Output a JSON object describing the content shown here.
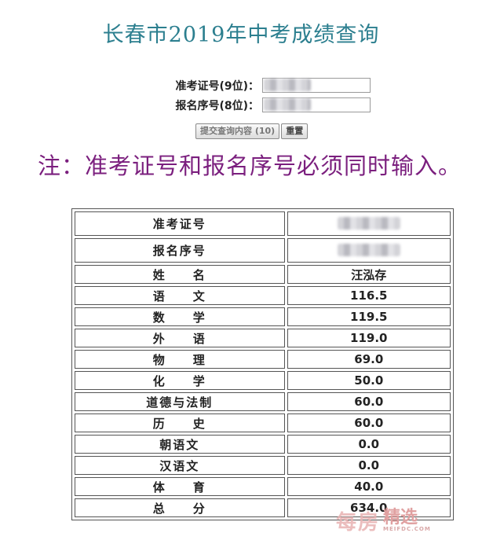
{
  "title": "长春市2019年中考成绩查询",
  "form": {
    "exam_id_label": "准考证号(9位)：",
    "reg_id_label": "报名序号(8位)：",
    "submit_label": "提交查询内容 (10)",
    "reset_label": "重置"
  },
  "note": "注：准考证号和报名序号必须同时输入。",
  "table": {
    "rows": [
      {
        "label": "准考证号",
        "value": ""
      },
      {
        "label": "报名序号",
        "value": ""
      },
      {
        "label": "姓　　名",
        "value": "汪泓存"
      },
      {
        "label": "语　　文",
        "value": "116.5"
      },
      {
        "label": "数　　学",
        "value": "119.5"
      },
      {
        "label": "外　　语",
        "value": "119.0"
      },
      {
        "label": "物　　理",
        "value": "69.0"
      },
      {
        "label": "化　　学",
        "value": "50.0"
      },
      {
        "label": "道德与法制",
        "value": "60.0"
      },
      {
        "label": "历　　史",
        "value": "60.0"
      },
      {
        "label": "朝语文",
        "value": "0.0"
      },
      {
        "label": "汉语文",
        "value": "0.0"
      },
      {
        "label": "体　　育",
        "value": "40.0"
      },
      {
        "label": "总　　分",
        "value": "634.0"
      }
    ]
  },
  "watermark": {
    "logo": "每房",
    "cn": "精选",
    "en": "MEIFDC.COM"
  }
}
